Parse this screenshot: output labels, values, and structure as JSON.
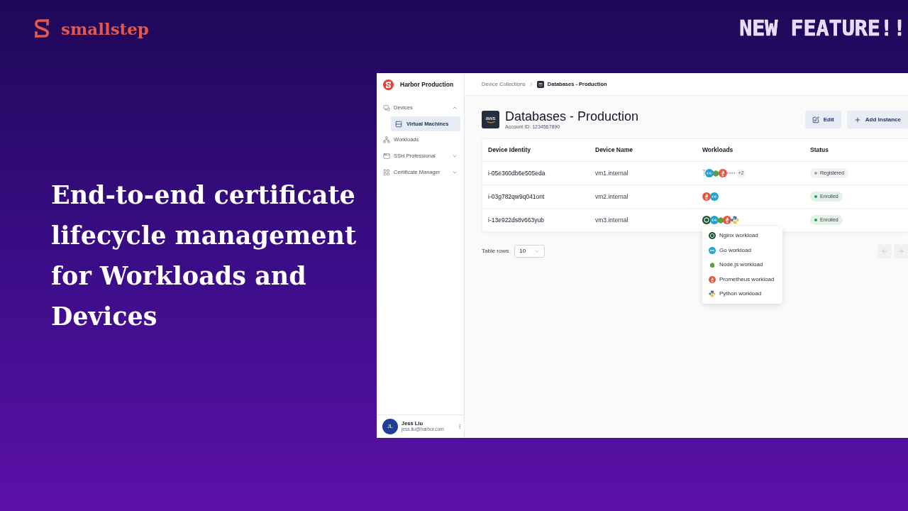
{
  "brand": {
    "name": "smallstep"
  },
  "banner": "NEW FEATURE!!",
  "headline": "End-to-end certificate lifecycle management for Workloads and Devices",
  "app": {
    "sidebar": {
      "org": "Harbor Production",
      "items": [
        {
          "label": "Devices",
          "kind": "devices",
          "expanded": true,
          "selected": false,
          "children": [
            {
              "label": "Virtual Machines",
              "kind": "vm",
              "selected": true
            }
          ]
        },
        {
          "label": "Workloads",
          "kind": "workloads",
          "selected": false
        },
        {
          "label": "SSH Professional",
          "kind": "ssh",
          "expanded": false,
          "selected": false
        },
        {
          "label": "Certificate Manager",
          "kind": "certs",
          "expanded": false,
          "selected": false
        }
      ],
      "user": {
        "initials": "JL",
        "name": "Jess Liu",
        "email": "jess.liu@harbor.com"
      }
    },
    "breadcrumb": {
      "separator": "/",
      "items": [
        {
          "label": "Device Collections",
          "kind": "text",
          "selected": false
        },
        {
          "label": "Databases - Production",
          "kind": "logo",
          "selected": true
        }
      ]
    },
    "header": {
      "logo_text": "aws",
      "title": "Databases - Production",
      "subtitle": "Account ID: 1234567890",
      "buttons": [
        {
          "label": "Edit",
          "kind": "edit"
        },
        {
          "label": "Add Instance",
          "kind": "add"
        }
      ]
    },
    "table": {
      "columns": [
        "Device Identity",
        "Device Name",
        "Workloads",
        "Status"
      ],
      "rows": [
        {
          "identity": "i-05e360db6e505eda",
          "name": "vm1.internal",
          "workloads": [
            {
              "kind": "other"
            },
            {
              "kind": "go"
            },
            {
              "kind": "node"
            },
            {
              "kind": "prometheus"
            },
            {
              "kind": "more"
            }
          ],
          "overflow": "+2",
          "status": {
            "label": "Registered",
            "color": "#a1a1aa"
          },
          "menu_open": false
        },
        {
          "identity": "i-03g782qw9q041ont",
          "name": "vm2.internal",
          "workloads": [
            {
              "kind": "prometheus"
            },
            {
              "kind": "go"
            }
          ],
          "status": {
            "label": "Enrolled",
            "color": "#22a05a"
          },
          "menu_open": false
        },
        {
          "identity": "i-13e922ds8v663yub",
          "name": "vm3.internal",
          "workloads": [
            {
              "kind": "nginx"
            },
            {
              "kind": "go"
            },
            {
              "kind": "node"
            },
            {
              "kind": "prometheus"
            },
            {
              "kind": "python"
            }
          ],
          "status": {
            "label": "Enrolled",
            "color": "#22a05a"
          },
          "menu_open": true,
          "menu": [
            {
              "label": "Nginx workload",
              "kind": "nginx"
            },
            {
              "label": "Go workload",
              "kind": "go"
            },
            {
              "label": "Node.js workload",
              "kind": "node"
            },
            {
              "label": "Prometheus workload",
              "kind": "prometheus"
            },
            {
              "label": "Python workload",
              "kind": "python"
            }
          ]
        }
      ]
    },
    "footer": {
      "rows_label": "Table rows",
      "rows_value": "10",
      "pager": [
        {
          "kind": "prev",
          "disabled": true
        },
        {
          "kind": "next",
          "disabled": true
        }
      ]
    }
  }
}
